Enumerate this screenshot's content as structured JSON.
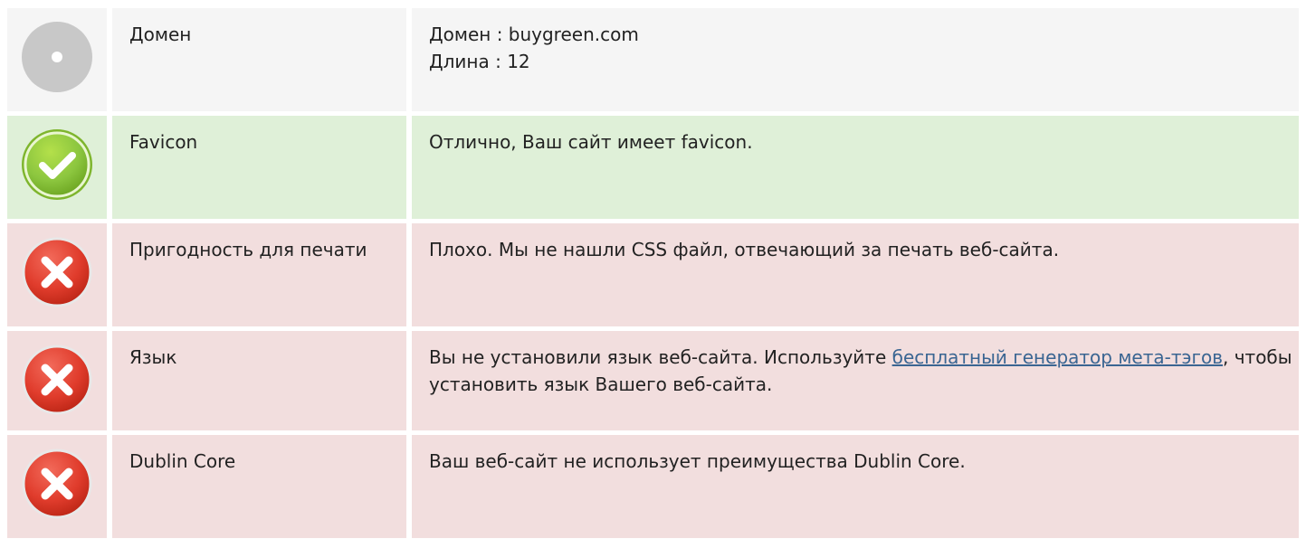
{
  "colors": {
    "neutral_bg": "#f5f5f5",
    "good_bg": "#dff0d8",
    "bad_bg": "#f2dede",
    "link": "#3a6592"
  },
  "rows": [
    {
      "status": "neutral",
      "icon": "info-dot-icon",
      "name": "Домен",
      "lines": [
        "Домен : buygreen.com",
        "Длина : 12"
      ]
    },
    {
      "status": "good",
      "icon": "check-icon",
      "name": "Favicon",
      "text": "Отлично, Ваш сайт имеет favicon."
    },
    {
      "status": "bad",
      "icon": "error-x-icon",
      "name": "Пригодность для печати",
      "text": "Плохо. Мы не нашли CSS файл, отвечающий за печать веб-сайта."
    },
    {
      "status": "bad",
      "icon": "error-x-icon",
      "name": "Язык",
      "text_before": "Вы не установили язык веб-сайта. Используйте ",
      "link_text": "бесплатный генератор мета-тэгов",
      "text_after": ", чтобы установить язык Вашего веб-сайта."
    },
    {
      "status": "bad",
      "icon": "error-x-icon",
      "name": "Dublin Core",
      "text": "Ваш веб-сайт не использует преимущества Dublin Core."
    }
  ]
}
